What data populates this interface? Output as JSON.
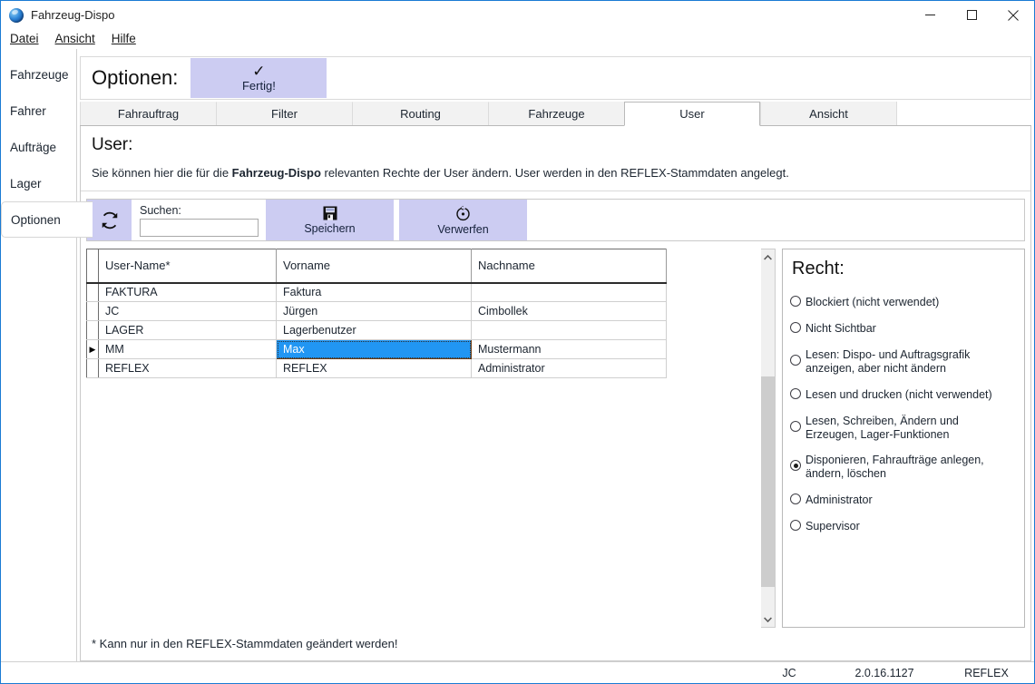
{
  "window": {
    "title": "Fahrzeug-Dispo",
    "icon": "app-globe-icon",
    "controls": {
      "minimize": "minimize-icon",
      "maximize": "maximize-icon",
      "close": "close-icon"
    }
  },
  "menubar": {
    "items": [
      "Datei",
      "Ansicht",
      "Hilfe"
    ]
  },
  "sidebar": {
    "items": [
      {
        "label": "Fahrzeuge",
        "active": false
      },
      {
        "label": "Fahrer",
        "active": false
      },
      {
        "label": "Aufträge",
        "active": false
      },
      {
        "label": "Lager",
        "active": false
      },
      {
        "label": "Optionen",
        "active": true
      }
    ]
  },
  "options_bar": {
    "label": "Optionen:",
    "done_button": {
      "label": "Fertig!",
      "icon": "check-icon",
      "color": "#ccccf2"
    }
  },
  "tabs": [
    {
      "label": "Fahrauftrag",
      "active": false
    },
    {
      "label": "Filter",
      "active": false
    },
    {
      "label": "Routing",
      "active": false
    },
    {
      "label": "Fahrzeuge",
      "active": false
    },
    {
      "label": "User",
      "active": true
    },
    {
      "label": "Ansicht",
      "active": false
    }
  ],
  "panel": {
    "title": "User:",
    "description_pre": "Sie können hier die für die ",
    "description_bold": "Fahrzeug-Dispo",
    "description_post": " relevanten Rechte der User ändern. User werden in den REFLEX-Stammdaten angelegt."
  },
  "toolbar": {
    "refresh": {
      "icon": "refresh-icon",
      "label": ""
    },
    "search": {
      "label": "Suchen:",
      "value": "",
      "placeholder": ""
    },
    "save": {
      "label": "Speichern",
      "icon": "floppy-disk-icon"
    },
    "discard": {
      "label": "Verwerfen",
      "icon": "undo-icon"
    }
  },
  "grid": {
    "columns": [
      "User-Name*",
      "Vorname",
      "Nachname"
    ],
    "rows": [
      {
        "selector": "",
        "user_name": "FAKTURA",
        "vorname": "Faktura",
        "nachname": ""
      },
      {
        "selector": "",
        "user_name": "JC",
        "vorname": "Jürgen",
        "nachname": "Cimbollek"
      },
      {
        "selector": "",
        "user_name": "LAGER",
        "vorname": "Lagerbenutzer",
        "nachname": ""
      },
      {
        "selector": "▶",
        "user_name": "MM",
        "vorname": "Max",
        "nachname": "Mustermann"
      },
      {
        "selector": "",
        "user_name": "REFLEX",
        "vorname": "REFLEX",
        "nachname": "Administrator"
      }
    ],
    "selected_row_index": 3,
    "selected_cell": "vorname",
    "selection_color": "#2196f3",
    "scrollbar": {
      "up_icon": "chevron-up-icon",
      "down_icon": "chevron-down-icon"
    }
  },
  "rights": {
    "title": "Recht:",
    "options": [
      {
        "label": "Blockiert (nicht verwendet)",
        "checked": false
      },
      {
        "label": "Nicht Sichtbar",
        "checked": false
      },
      {
        "label": "Lesen: Dispo- und Auftragsgrafik anzeigen, aber nicht ändern",
        "checked": false
      },
      {
        "label": "Lesen und drucken (nicht verwendet)",
        "checked": false
      },
      {
        "label": "Lesen, Schreiben, Ändern und Erzeugen, Lager-Funktionen",
        "checked": false
      },
      {
        "label": "Disponieren, Fahraufträge anlegen, ändern, löschen",
        "checked": true
      },
      {
        "label": "Administrator",
        "checked": false
      },
      {
        "label": "Supervisor",
        "checked": false
      }
    ]
  },
  "footnote": "* Kann nur in den REFLEX-Stammdaten geändert werden!",
  "statusbar": {
    "user": "JC",
    "version": "2.0.16.1127",
    "database": "REFLEX"
  }
}
